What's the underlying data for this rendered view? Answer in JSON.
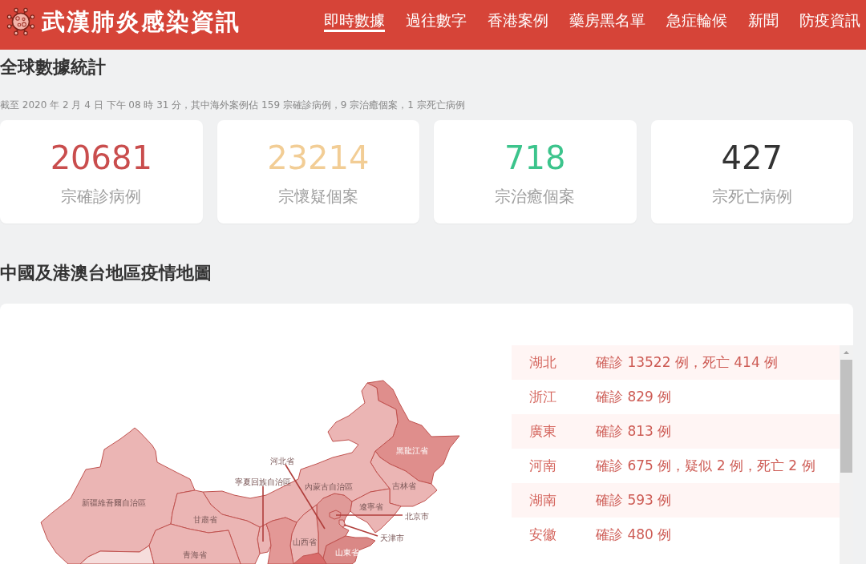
{
  "header": {
    "title": "武漢肺炎感染資訊",
    "nav": [
      {
        "label": "即時數據",
        "selected": true
      },
      {
        "label": "過往數字",
        "selected": false
      },
      {
        "label": "香港案例",
        "selected": false
      },
      {
        "label": "藥房黑名單",
        "selected": false
      },
      {
        "label": "急症輪候",
        "selected": false
      },
      {
        "label": "新聞",
        "selected": false
      },
      {
        "label": "防疫資訊",
        "selected": false
      }
    ]
  },
  "global_stats": {
    "title": "全球數據統計",
    "note": "截至 2020 年 2 月 4 日 下午 08 時 31 分，其中海外案例佔 159 宗確診病例，9 宗治癒個案，1 宗死亡病例",
    "cards": [
      {
        "value": "20681",
        "label": "宗確診病例",
        "color": "#c94d4d"
      },
      {
        "value": "23214",
        "label": "宗懷疑個案",
        "color": "#f2cd95"
      },
      {
        "value": "718",
        "label": "宗治癒個案",
        "color": "#3cc48c"
      },
      {
        "value": "427",
        "label": "宗死亡病例",
        "color": "#333333"
      }
    ]
  },
  "china_map": {
    "title": "中國及港澳台地區疫情地圖",
    "regions": [
      {
        "label": "黑龍江省",
        "color": "#df8e8c"
      },
      {
        "label": "河北省",
        "color": "#e09a98"
      },
      {
        "label": "吉林省",
        "color": "#ebb5b4"
      },
      {
        "label": "寧夏回族自治區",
        "color": "#ebb5b4"
      },
      {
        "label": "內蒙古自治區",
        "color": "#ebb5b4"
      },
      {
        "label": "新疆維吾爾自治區",
        "color": "#ebb5b4"
      },
      {
        "label": "遼寧省",
        "color": "#ebb5b4"
      },
      {
        "label": "甘肅省",
        "color": "#ebb5b4"
      },
      {
        "label": "北京市",
        "color": "#e09a98"
      },
      {
        "label": "山西省",
        "color": "#ebb5b4"
      },
      {
        "label": "天津市",
        "color": "#ebb5b4"
      },
      {
        "label": "山東省",
        "color": "#da8886"
      },
      {
        "label": "青海省",
        "color": "#ebb5b4"
      },
      {
        "color": "#f6dddc"
      },
      {
        "color": "#e39896"
      },
      {
        "color": "#d96c6b"
      }
    ],
    "province_list": [
      {
        "province": "湖北",
        "detail": "確診 13522 例，死亡 414 例"
      },
      {
        "province": "浙江",
        "detail": "確診 829 例"
      },
      {
        "province": "廣東",
        "detail": "確診 813 例"
      },
      {
        "province": "河南",
        "detail": "確診 675 例，疑似 2 例，死亡 2 例"
      },
      {
        "province": "湖南",
        "detail": "確診 593 例"
      },
      {
        "province": "安徽",
        "detail": "確診 480 例"
      }
    ]
  }
}
